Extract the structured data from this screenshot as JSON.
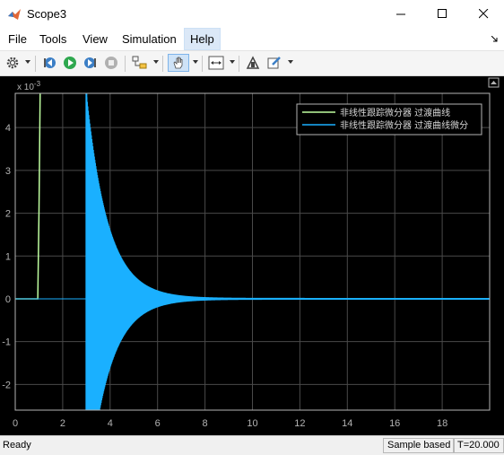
{
  "window": {
    "title": "Scope3"
  },
  "menu": {
    "items": [
      "File",
      "Tools",
      "View",
      "Simulation",
      "Help"
    ],
    "active": "Help"
  },
  "toolbar": {
    "icons": [
      "gear-icon",
      "step-back-icon",
      "run-icon",
      "step-forward-icon",
      "stop-icon",
      "highlight-block-icon",
      "pan-icon",
      "zoom-x-icon",
      "autoscale-icon",
      "edit-icon"
    ]
  },
  "status": {
    "ready": "Ready",
    "sample_mode": "Sample based",
    "time": "T=20.000"
  },
  "chart_data": {
    "type": "line",
    "exponent_label": "x 10",
    "exponent_power": "-3",
    "xlim": [
      0,
      20
    ],
    "ylim": [
      -2.6,
      4.8
    ],
    "x_ticks": [
      0,
      2,
      4,
      6,
      8,
      10,
      12,
      14,
      16,
      18
    ],
    "x_tick_labels": [
      "0",
      "2",
      "4",
      "6",
      "8",
      "10",
      "12",
      "14",
      "16",
      "18"
    ],
    "y_ticks": [
      4,
      3,
      2,
      1,
      0,
      -1,
      -2
    ],
    "y_tick_labels": [
      "4",
      "3",
      "2",
      "1",
      "0",
      "-1",
      "-2"
    ],
    "grid": true,
    "legend_position": "top-right",
    "series": [
      {
        "name": "非线性跟踪微分器 过渡曲线",
        "color": "#bfffa0",
        "points": [
          [
            0,
            0
          ],
          [
            0.95,
            0
          ],
          [
            1.0,
            2.0
          ],
          [
            1.05,
            4.8
          ]
        ]
      },
      {
        "name": "非线性跟踪微分器 过渡曲线微分",
        "color": "#1ab0ff",
        "points": [
          [
            0,
            0
          ],
          [
            20,
            0
          ]
        ],
        "oscillation": {
          "start": 3.0,
          "end": 20,
          "initial_amp": 4.8,
          "decay": 1.1
        }
      }
    ],
    "background": "#000000",
    "axis_color": "#b3b3b3"
  }
}
